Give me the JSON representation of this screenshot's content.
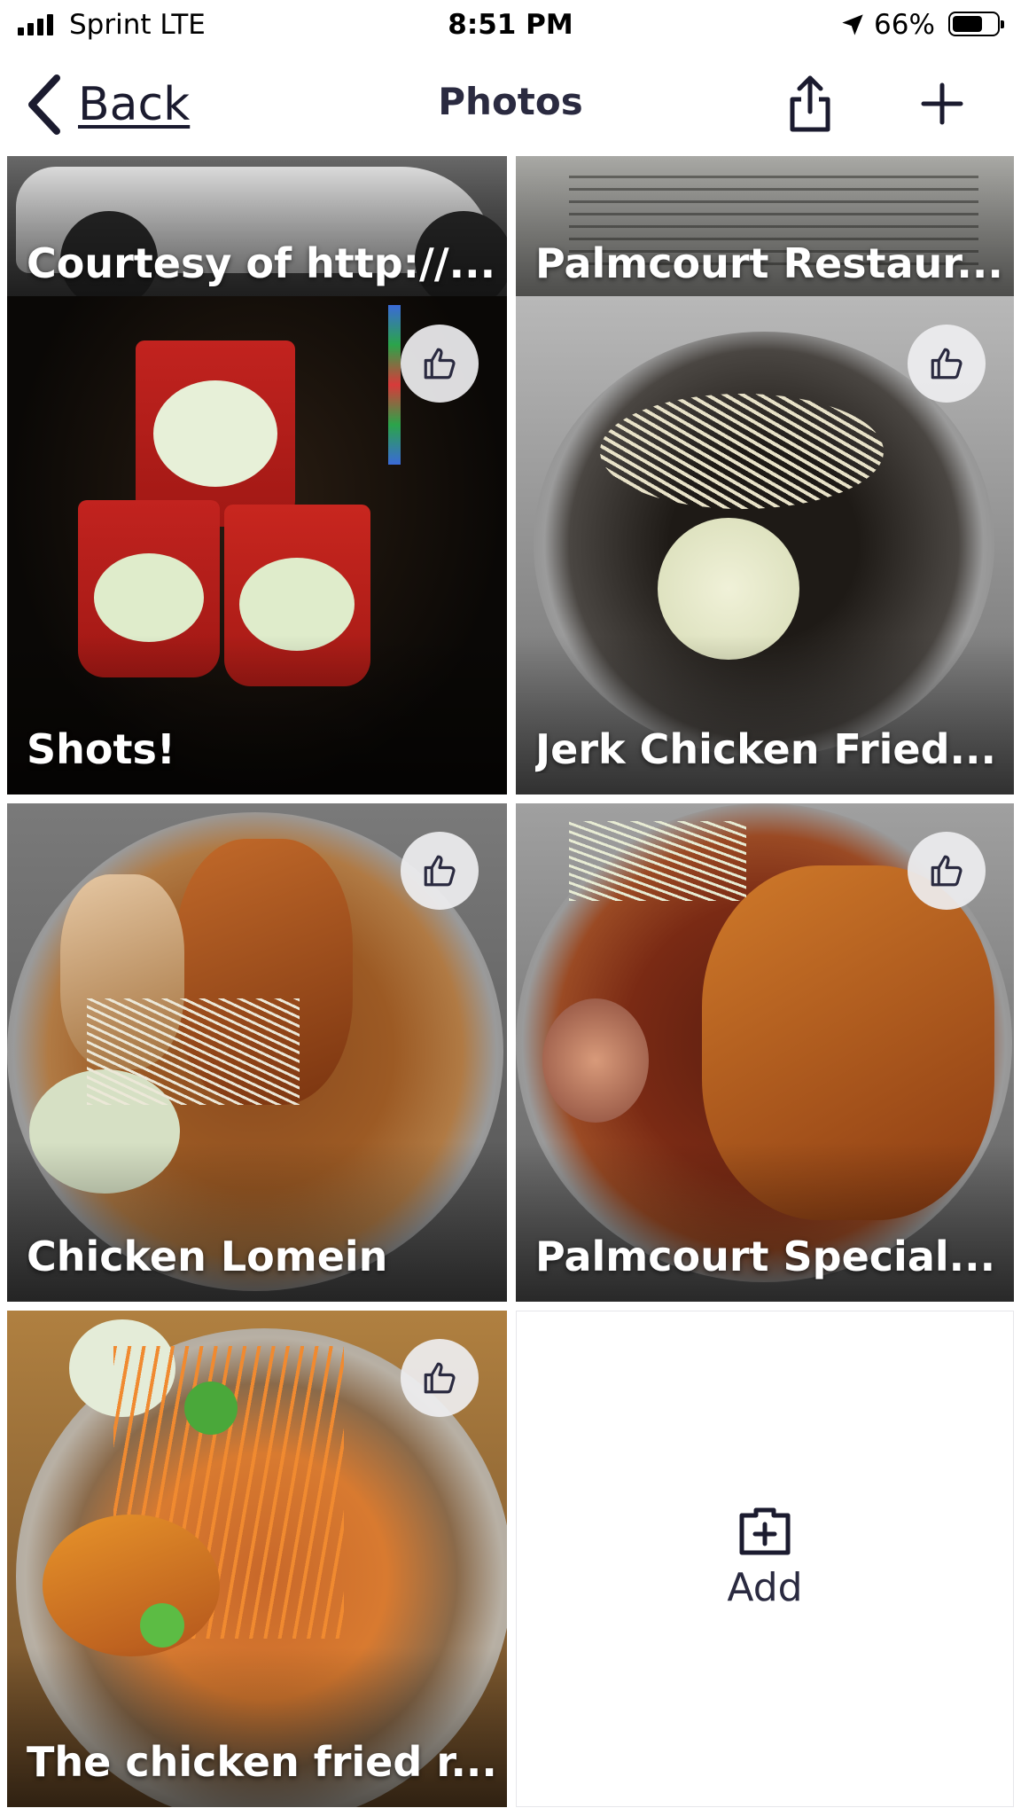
{
  "status_bar": {
    "carrier": "Sprint  LTE",
    "time": "8:51 PM",
    "battery": "66%",
    "battery_level": 0.66
  },
  "nav": {
    "back_label": "Back",
    "title": "Photos"
  },
  "photos": [
    {
      "caption": "Courtesy of http://..."
    },
    {
      "caption": "Palmcourt Restaur..."
    },
    {
      "caption": "Shots!"
    },
    {
      "caption": "Jerk Chicken Fried..."
    },
    {
      "caption": "Chicken Lomein"
    },
    {
      "caption": "Palmcourt Special..."
    },
    {
      "caption": "The chicken fried r..."
    }
  ],
  "add_tile": {
    "label": "Add"
  },
  "colors": {
    "text_dark": "#1b1b2f",
    "like_bg": "#eeeef0"
  }
}
